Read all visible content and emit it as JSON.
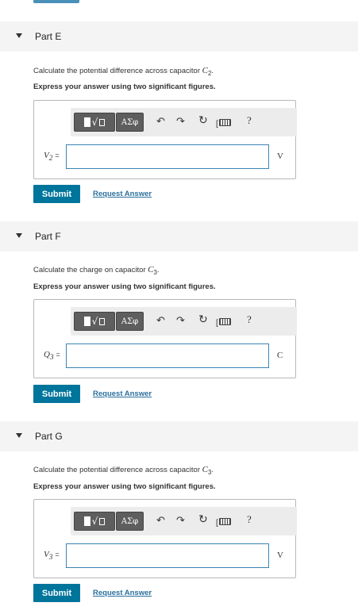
{
  "toolbar": {
    "greek_label": "ΑΣφ",
    "undo_icon": "undo-arrow-icon",
    "redo_icon": "redo-arrow-icon",
    "reset_icon": "reset-icon",
    "keyboard_icon": "keyboard-icon",
    "help_label": "?"
  },
  "parts": [
    {
      "title": "Part E",
      "question_prefix": "Calculate the potential difference across capacitor ",
      "question_var": "C",
      "question_sub": "2",
      "question_suffix": ".",
      "instruction": "Express your answer using two significant figures.",
      "var": "V",
      "var_sub": "2",
      "eq": "=",
      "unit": "V",
      "input_value": "",
      "submit_label": "Submit",
      "request_label": "Request Answer"
    },
    {
      "title": "Part F",
      "question_prefix": "Calculate the charge on capacitor ",
      "question_var": "C",
      "question_sub": "3",
      "question_suffix": ".",
      "instruction": "Express your answer using two significant figures.",
      "var": "Q",
      "var_sub": "3",
      "eq": "=",
      "unit": "C",
      "input_value": "",
      "submit_label": "Submit",
      "request_label": "Request Answer"
    },
    {
      "title": "Part G",
      "question_prefix": "Calculate the potential difference across capacitor ",
      "question_var": "C",
      "question_sub": "3",
      "question_suffix": ".",
      "instruction": "Express your answer using two significant figures.",
      "var": "V",
      "var_sub": "3",
      "eq": "=",
      "unit": "V",
      "input_value": "",
      "submit_label": "Submit",
      "request_label": "Request Answer"
    }
  ],
  "colors": {
    "accent": "#00759c",
    "link": "#2a6f9e",
    "header_bg": "#f4f4f4",
    "input_border": "#3a85b5"
  }
}
